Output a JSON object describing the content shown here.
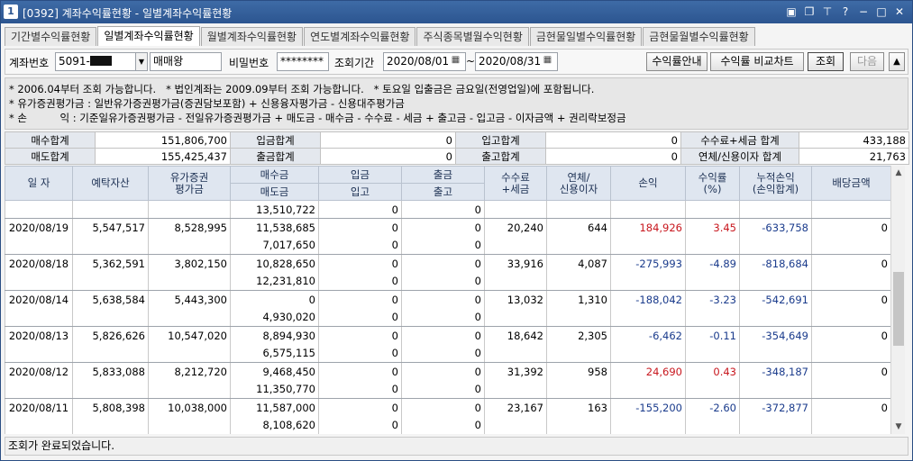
{
  "window": {
    "screen_no": "1",
    "title": "[0392] 계좌수익률현황 - 일별계좌수익률현황",
    "icons": [
      "window-icon",
      "restore-icon",
      "pin-icon",
      "help-icon",
      "minimize-icon",
      "maximize-icon",
      "close-icon"
    ]
  },
  "tabs": [
    {
      "label": "기간별수익률현황"
    },
    {
      "label": "일별계좌수익률현황"
    },
    {
      "label": "월별계좌수익률현황"
    },
    {
      "label": "연도별계좌수익률현황"
    },
    {
      "label": "주식종목별월수익현황"
    },
    {
      "label": "금현물일별수익률현황"
    },
    {
      "label": "금현물월별수익률현황"
    }
  ],
  "toolbar": {
    "account_label": "계좌번호",
    "account_value": "5091-",
    "account_name": "매매왕",
    "password_label": "비밀번호",
    "password_value": "********",
    "period_label": "조회기간",
    "date_from": "2020/08/01",
    "date_sep": "~",
    "date_to": "2020/08/31",
    "btn_guide": "수익률안내",
    "btn_compare": "수익률 비교차트",
    "btn_query": "조회",
    "btn_next": "다음",
    "btn_up": "▲"
  },
  "info": [
    "* 2006.04부터 조회 가능합니다.   * 법인계좌는 2009.09부터 조회 가능합니다.   * 토요일 입출금은 금요일(전영업일)에 포함됩니다.",
    "* 유가증권평가금 : 일반유가증권평가금(증권담보포함) + 신용융자평가금 - 신용대주평가금",
    "* 손          익 : 기준일유가증권평가금 - 전일유가증권평가금 + 매도금 - 매수금 - 수수료 - 세금 + 출고금 - 입고금 - 이자금액 + 권리락보정금"
  ],
  "summary": {
    "buy_total_label": "매수합계",
    "buy_total": "151,806,700",
    "deposit_total_label": "입금합계",
    "deposit_total": "0",
    "in_total_label": "입고합계",
    "in_total": "0",
    "fee_tax_label": "수수료+세금 합계",
    "fee_tax": "433,188",
    "sell_total_label": "매도합계",
    "sell_total": "155,425,437",
    "withdraw_total_label": "출금합계",
    "withdraw_total": "0",
    "out_total_label": "출고합계",
    "out_total": "0",
    "interest_label": "연체/신용이자 합계",
    "interest": "21,763"
  },
  "grid": {
    "headers": {
      "date": "일 자",
      "deposit_asset": "예탁자산",
      "securities_eval_1": "유가증권",
      "securities_eval_2": "평가금",
      "buy": "매수금",
      "sell": "매도금",
      "deposit": "입금",
      "in": "입고",
      "withdraw": "출금",
      "out": "출고",
      "fee_1": "수수료",
      "fee_2": "+세금",
      "interest_1": "연체/",
      "interest_2": "신용이자",
      "pnl": "손익",
      "return_1": "수익률",
      "return_2": "(%)",
      "cum_1": "누적손익",
      "cum_2": "(손익합계)",
      "dividend": "배당금액"
    },
    "top_partial": {
      "sell": "13,510,722",
      "in": "0",
      "out": "0"
    },
    "rows": [
      {
        "date": "2020/08/19",
        "asset": "5,547,517",
        "eval": "8,528,995",
        "buy": "11,538,685",
        "deposit": "0",
        "withdraw": "0",
        "fee": "20,240",
        "interest": "644",
        "pnl": "184,926",
        "ret": "3.45",
        "cum": "-633,758",
        "div": "0",
        "sell": "7,017,650",
        "in": "0",
        "out": "0",
        "sign": "pos"
      },
      {
        "date": "2020/08/18",
        "asset": "5,362,591",
        "eval": "3,802,150",
        "buy": "10,828,650",
        "deposit": "0",
        "withdraw": "0",
        "fee": "33,916",
        "interest": "4,087",
        "pnl": "-275,993",
        "ret": "-4.89",
        "cum": "-818,684",
        "div": "0",
        "sell": "12,231,810",
        "in": "0",
        "out": "0",
        "sign": "neg"
      },
      {
        "date": "2020/08/14",
        "asset": "5,638,584",
        "eval": "5,443,300",
        "buy": "0",
        "deposit": "0",
        "withdraw": "0",
        "fee": "13,032",
        "interest": "1,310",
        "pnl": "-188,042",
        "ret": "-3.23",
        "cum": "-542,691",
        "div": "0",
        "sell": "4,930,020",
        "in": "0",
        "out": "0",
        "sign": "neg"
      },
      {
        "date": "2020/08/13",
        "asset": "5,826,626",
        "eval": "10,547,020",
        "buy": "8,894,930",
        "deposit": "0",
        "withdraw": "0",
        "fee": "18,642",
        "interest": "2,305",
        "pnl": "-6,462",
        "ret": "-0.11",
        "cum": "-354,649",
        "div": "0",
        "sell": "6,575,115",
        "in": "0",
        "out": "0",
        "sign": "neg"
      },
      {
        "date": "2020/08/12",
        "asset": "5,833,088",
        "eval": "8,212,720",
        "buy": "9,468,450",
        "deposit": "0",
        "withdraw": "0",
        "fee": "31,392",
        "interest": "958",
        "pnl": "24,690",
        "ret": "0.43",
        "cum": "-348,187",
        "div": "0",
        "sell": "11,350,770",
        "in": "0",
        "out": "0",
        "sign": "pos"
      },
      {
        "date": "2020/08/11",
        "asset": "5,808,398",
        "eval": "10,038,000",
        "buy": "11,587,000",
        "deposit": "0",
        "withdraw": "0",
        "fee": "23,167",
        "interest": "163",
        "pnl": "-155,200",
        "ret": "-2.60",
        "cum": "-372,877",
        "div": "0",
        "sell": "8,108,620",
        "in": "0",
        "out": "0",
        "sign": "neg"
      }
    ]
  },
  "status": "조회가 완료되었습니다.",
  "colors": {
    "positive": "#c8171e",
    "negative": "#1a3b8c",
    "title_bar": "#2c5590",
    "header_bg": "#dfe6f0"
  }
}
